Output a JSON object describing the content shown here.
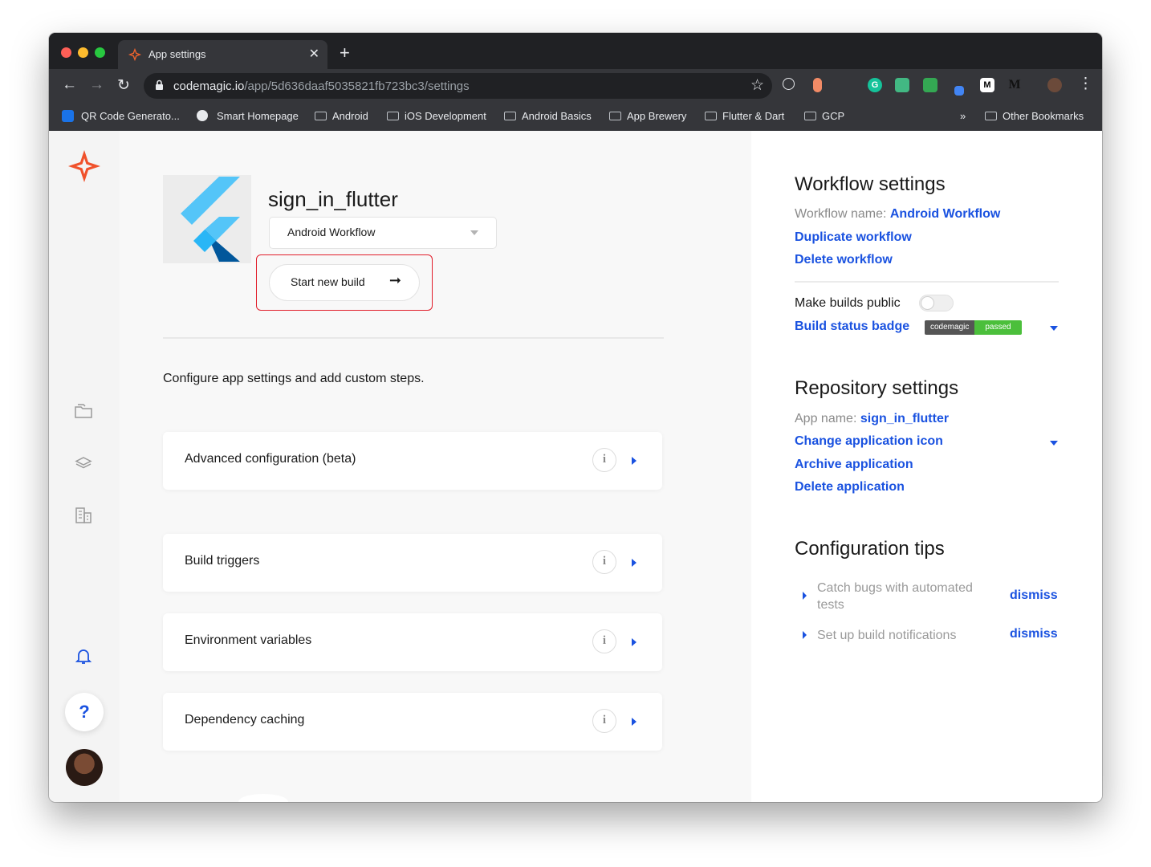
{
  "browser": {
    "tab_title": "App settings",
    "url_host": "codemagic.io",
    "url_path": "/app/5d636daaf5035821fb723bc3/settings",
    "bookmarks": [
      "QR Code Generato...",
      "Smart Homepage",
      "Android",
      "iOS Development",
      "Android Basics",
      "App Brewery",
      "Flutter & Dart",
      "GCP"
    ],
    "bookmarks_overflow": "»",
    "other_bookmarks": "Other Bookmarks"
  },
  "app": {
    "name": "sign_in_flutter",
    "workflow_selected": "Android Workflow",
    "start_build_label": "Start new build",
    "intro": "Configure app settings and add custom steps.",
    "sections": [
      "Advanced configuration (beta)",
      "Build triggers",
      "Environment variables",
      "Dependency caching"
    ]
  },
  "workflow_settings": {
    "heading": "Workflow settings",
    "name_label": "Workflow name:",
    "name_value": "Android Workflow",
    "duplicate": "Duplicate workflow",
    "delete": "Delete workflow",
    "make_public": "Make builds public",
    "make_public_on": false,
    "badge_link": "Build status badge",
    "badge_left": "codemagic",
    "badge_right": "passed"
  },
  "repository_settings": {
    "heading": "Repository settings",
    "app_name_label": "App name:",
    "app_name_value": "sign_in_flutter",
    "change_icon": "Change application icon",
    "archive": "Archive application",
    "delete": "Delete application"
  },
  "config_tips": {
    "heading": "Configuration tips",
    "tips": [
      "Catch bugs with automated tests",
      "Set up build notifications"
    ],
    "dismiss_label": "dismiss"
  },
  "leftnav": {
    "help": "?"
  },
  "colors": {
    "accent": "#1a52e0",
    "highlight_box": "#e11d2a",
    "badge_passed": "#4bbf3b"
  }
}
